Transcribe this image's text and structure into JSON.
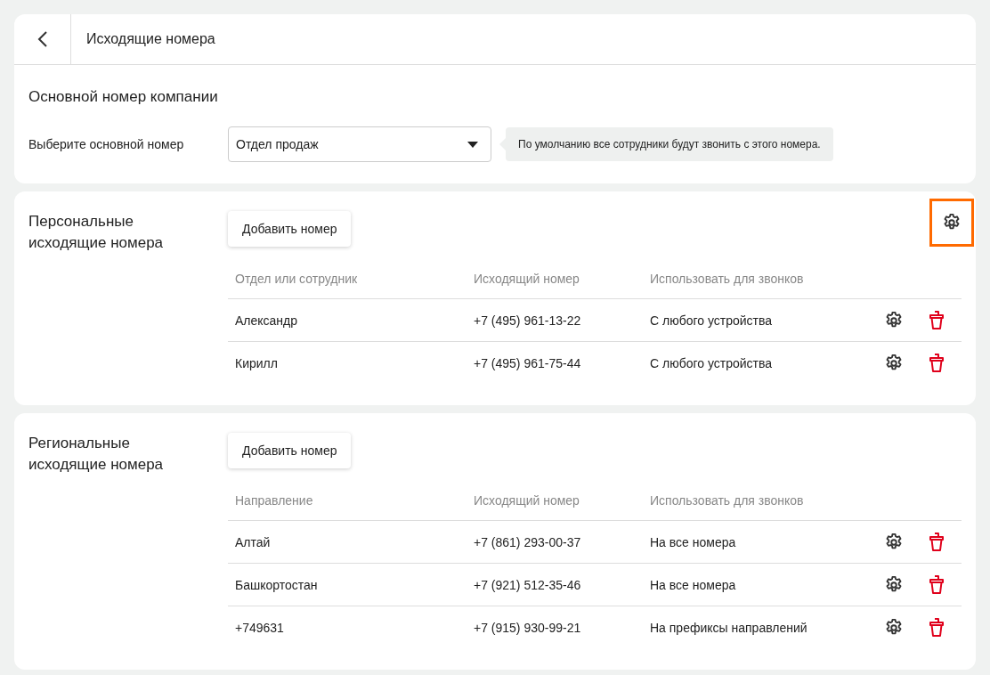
{
  "header": {
    "title": "Исходящие номера"
  },
  "main_number": {
    "title": "Основной номер компании",
    "label": "Выберите основной номер",
    "value": "Отдел продаж",
    "hint": "По умолчанию все сотрудники будут звонить с этого номера."
  },
  "sections": [
    {
      "title": "Персональные исходящие номера",
      "add_button": "Добавить номер",
      "settings_highlighted": true,
      "columns": [
        "Отдел или сотрудник",
        "Исходящий номер",
        "Использовать для звонков"
      ],
      "rows": [
        {
          "name": "Александр",
          "number": "+7 (495) 961-13-22",
          "usage": "С любого устройства"
        },
        {
          "name": "Кирилл",
          "number": "+7 (495) 961-75-44",
          "usage": "С любого устройства"
        }
      ]
    },
    {
      "title": "Региональные исходящие номера",
      "add_button": "Добавить номер",
      "settings_highlighted": false,
      "columns": [
        "Направление",
        "Исходящий номер",
        "Использовать для звонков"
      ],
      "rows": [
        {
          "name": "Алтай",
          "number": "+7 (861) 293-00-37",
          "usage": "На все номера"
        },
        {
          "name": "Башкортостан",
          "number": "+7 (921) 512-35-46",
          "usage": "На все номера"
        },
        {
          "name": "+749631",
          "number": "+7 (915) 930-99-21",
          "usage": "На префиксы направлений"
        }
      ]
    }
  ]
}
